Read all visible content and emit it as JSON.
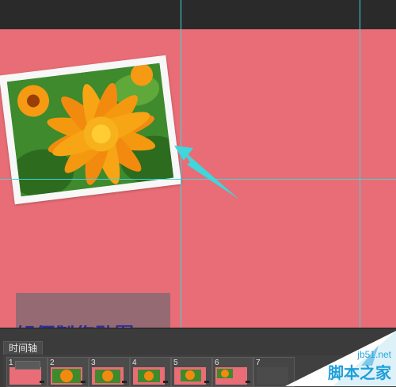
{
  "timeline": {
    "tab_label": "时间轴",
    "frames": [
      {
        "number": "1"
      },
      {
        "number": "2"
      },
      {
        "number": "3"
      },
      {
        "number": "4"
      },
      {
        "number": "5"
      },
      {
        "number": "6"
      },
      {
        "number": "7"
      }
    ]
  },
  "canvas": {
    "background_color": "#e96d76",
    "guide_color": "#3fd6dc"
  },
  "overlay": {
    "partial_text": "如何制作动图"
  },
  "watermark": {
    "site": "jb51.net",
    "name": "脚本之家"
  }
}
